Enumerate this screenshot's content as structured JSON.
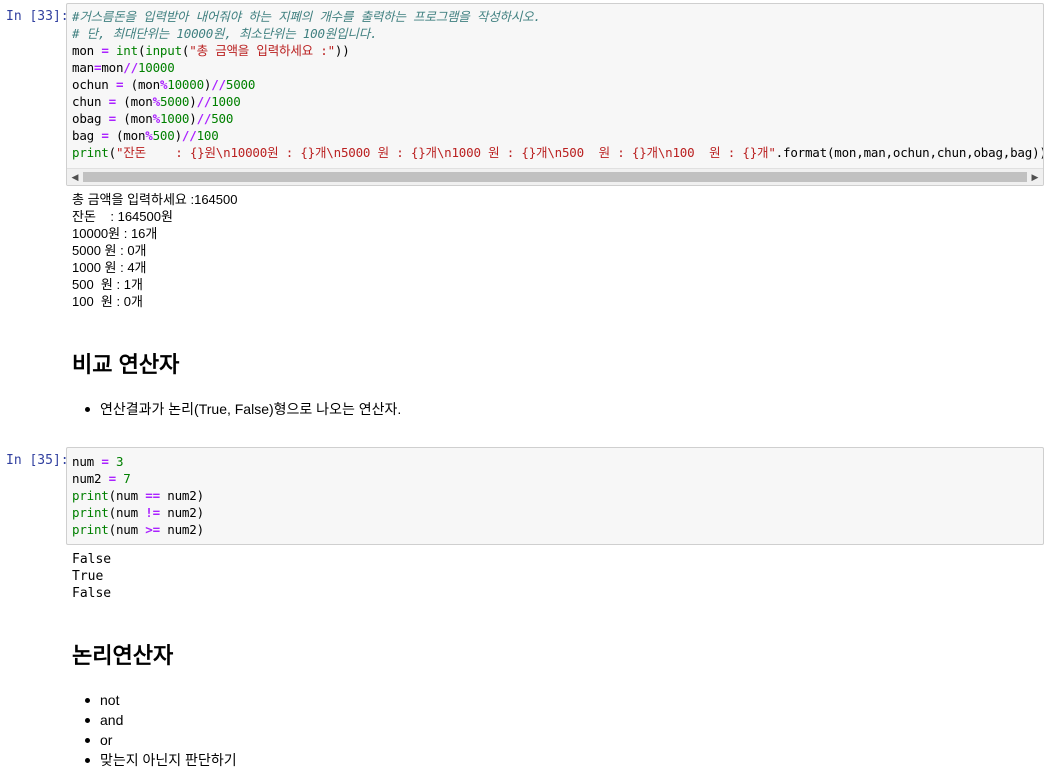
{
  "cells": [
    {
      "prompt": "In [33]:",
      "code_lines": [
        [
          [
            "cm",
            "#거스름돈을 입력받아 내어줘야 하는 지폐의 개수를 출력하는 프로그램을 작성하시오."
          ]
        ],
        [
          [
            "cm",
            "# 단, 최대단위는 10000원, 최소단위는 100원입니다."
          ]
        ],
        [
          [
            "",
            "mon "
          ],
          [
            "op",
            "="
          ],
          [
            "",
            " "
          ],
          [
            "kw",
            "int"
          ],
          [
            "",
            "("
          ],
          [
            "kw",
            "input"
          ],
          [
            "",
            "("
          ],
          [
            "str",
            "\"총 금액을 입력하세요 :\""
          ],
          [
            "",
            "))"
          ]
        ],
        [
          [
            "",
            "man"
          ],
          [
            "op",
            "="
          ],
          [
            "",
            "mon"
          ],
          [
            "op",
            "//"
          ],
          [
            "num",
            "10000"
          ]
        ],
        [
          [
            "",
            "ochun "
          ],
          [
            "op",
            "="
          ],
          [
            "",
            " (mon"
          ],
          [
            "op",
            "%"
          ],
          [
            "num",
            "10000"
          ],
          [
            "",
            ")"
          ],
          [
            "op",
            "//"
          ],
          [
            "num",
            "5000"
          ]
        ],
        [
          [
            "",
            "chun "
          ],
          [
            "op",
            "="
          ],
          [
            "",
            " (mon"
          ],
          [
            "op",
            "%"
          ],
          [
            "num",
            "5000"
          ],
          [
            "",
            ")"
          ],
          [
            "op",
            "//"
          ],
          [
            "num",
            "1000"
          ]
        ],
        [
          [
            "",
            "obag "
          ],
          [
            "op",
            "="
          ],
          [
            "",
            " (mon"
          ],
          [
            "op",
            "%"
          ],
          [
            "num",
            "1000"
          ],
          [
            "",
            ")"
          ],
          [
            "op",
            "//"
          ],
          [
            "num",
            "500"
          ]
        ],
        [
          [
            "",
            "bag "
          ],
          [
            "op",
            "="
          ],
          [
            "",
            " (mon"
          ],
          [
            "op",
            "%"
          ],
          [
            "num",
            "500"
          ],
          [
            "",
            ")"
          ],
          [
            "op",
            "//"
          ],
          [
            "num",
            "100"
          ]
        ],
        [
          [
            "kw",
            "print"
          ],
          [
            "",
            "("
          ],
          [
            "str",
            "\"잔돈    : {}원\\n10000원 : {}개\\n5000 원 : {}개\\n1000 원 : {}개\\n500  원 : {}개\\n100  원 : {}개\""
          ],
          [
            "",
            ".format(mon,man,ochun,chun,obag,bag))"
          ]
        ]
      ],
      "output": "총 금액을 입력하세요 :164500\n잔돈    : 164500원\n10000원 : 16개\n5000 원 : 0개\n1000 원 : 4개\n500  원 : 1개\n100  원 : 0개"
    },
    {
      "prompt": "In [35]:",
      "code_lines": [
        [
          [
            "",
            "num "
          ],
          [
            "op",
            "="
          ],
          [
            "",
            " "
          ],
          [
            "num",
            "3"
          ]
        ],
        [
          [
            "",
            "num2 "
          ],
          [
            "op",
            "="
          ],
          [
            "",
            " "
          ],
          [
            "num",
            "7"
          ]
        ],
        [
          [
            "kw",
            "print"
          ],
          [
            "",
            "(num "
          ],
          [
            "op",
            "=="
          ],
          [
            "",
            " num2)"
          ]
        ],
        [
          [
            "kw",
            "print"
          ],
          [
            "",
            "(num "
          ],
          [
            "op",
            "!="
          ],
          [
            "",
            " num2)"
          ]
        ],
        [
          [
            "kw",
            "print"
          ],
          [
            "",
            "(num "
          ],
          [
            "op",
            ">="
          ],
          [
            "",
            " num2)"
          ]
        ]
      ],
      "output": "False\nTrue\nFalse"
    }
  ],
  "markdown1": {
    "heading": "비교 연산자",
    "items": [
      "연산결과가 논리(True, False)형으로 나오는 연산자."
    ]
  },
  "markdown2": {
    "heading": "논리연산자",
    "items": [
      "not",
      "and",
      "or",
      "맞는지 아닌지 판단하기"
    ]
  },
  "scrollbar": {
    "left_arrow": "◀",
    "right_arrow": "▶"
  }
}
